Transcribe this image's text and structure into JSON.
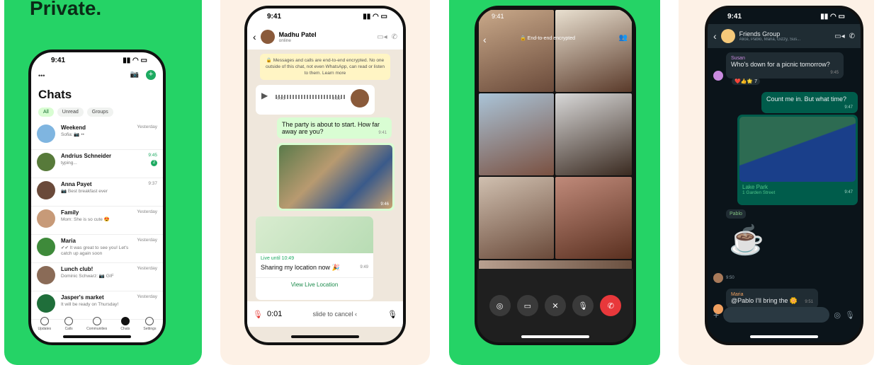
{
  "panel1": {
    "headline": "Private.",
    "time": "9:41",
    "title": "Chats",
    "filters": [
      "All",
      "Unread",
      "Groups"
    ],
    "chats": [
      {
        "name": "Weekend",
        "preview": "Sofia: 📷 ••",
        "time": "Yesterday",
        "avatar_color": "#7fb5e0"
      },
      {
        "name": "Andrius Schneider",
        "preview": "typing...",
        "time": "9:45",
        "unread": "2",
        "avatar_color": "#577a3a"
      },
      {
        "name": "Anna Payet",
        "preview": "📷 Best breakfast ever",
        "time": "9:37",
        "avatar_color": "#6a4a3a"
      },
      {
        "name": "Family",
        "preview": "Mom: She is so cute 😍",
        "time": "Yesterday",
        "avatar_color": "#c79a78"
      },
      {
        "name": "Maria",
        "preview": "✔✔ It was great to see you! Let's catch up again soon",
        "time": "Yesterday",
        "avatar_color": "#3e8a3a"
      },
      {
        "name": "Lunch club!",
        "preview": "Dominic Schwarz: 📷 GIF",
        "time": "Yesterday",
        "avatar_color": "#8a6b57"
      },
      {
        "name": "Jasper's market",
        "preview": "It will be ready on Thursday!",
        "time": "Yesterday",
        "avatar_color": "#1f6e3a"
      }
    ],
    "nav": [
      "Updates",
      "Calls",
      "Communities",
      "Chats",
      "Settings"
    ]
  },
  "panel2": {
    "time": "9:41",
    "contact": "Madhu Patel",
    "status": "online",
    "system": "🔒 Messages and calls are end-to-end encrypted. No one outside of this chat, not even WhatsApp, can read or listen to them. Learn more",
    "voice_start": "0:05",
    "voice_end": "9:35",
    "msg1": "The party is about to start. How far away are you?",
    "msg1_time": "9:41",
    "photo_time": "9:46",
    "live_until": "Live until 10:49",
    "share": "Sharing my location now 🎉",
    "share_time": "9:49",
    "view_live": "View Live Location",
    "rec_time": "0:01",
    "slide": "slide to cancel ‹"
  },
  "panel3": {
    "time": "9:41",
    "encrypted": "🔒 End-to-end encrypted"
  },
  "panel4": {
    "time": "9:41",
    "group": "Friends Group",
    "members": "Alice, Pablo, Maria, Gizzy, Sus...",
    "sender1": "Susan",
    "msg1": "Who's down for a picnic tomorrow?",
    "msg1_time": "9:45",
    "reactions": "❤️👍🌟 7",
    "msg2": "Count me in. But what time?",
    "msg2_time": "9:47",
    "place": "Lake Park",
    "street": "1 Garden Street",
    "map_time": "9:47",
    "sender2": "Pablo",
    "sticker_time": "9:50",
    "sender3": "Maria",
    "msg3": "@Pablo I'll bring the 🌼",
    "msg3_time": "9:51"
  }
}
